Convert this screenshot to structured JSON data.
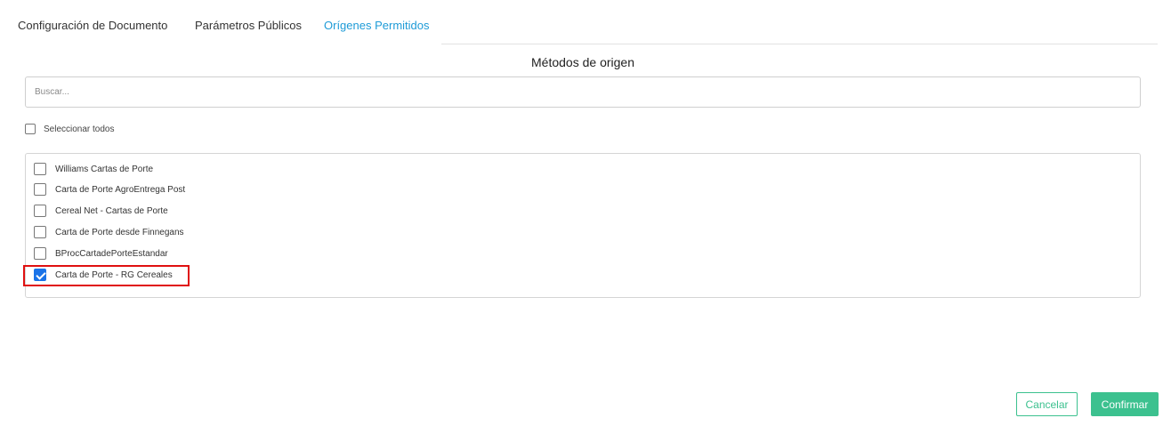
{
  "tabs": [
    {
      "label": "Configuración de Documento",
      "active": false
    },
    {
      "label": "Parámetros Públicos",
      "active": false
    },
    {
      "label": "Orígenes Permitidos",
      "active": true
    }
  ],
  "section": {
    "title": "Métodos de origen"
  },
  "search": {
    "placeholder": "Buscar...",
    "value": ""
  },
  "select_all": {
    "label": "Seleccionar todos",
    "checked": false
  },
  "origins": [
    {
      "label": "Williams Cartas de Porte",
      "checked": false
    },
    {
      "label": "Carta de Porte AgroEntrega Post",
      "checked": false
    },
    {
      "label": "Cereal Net - Cartas de Porte",
      "checked": false
    },
    {
      "label": "Carta de Porte desde Finnegans",
      "checked": false
    },
    {
      "label": "BProcCartadePorteEstandar",
      "checked": false
    },
    {
      "label": "Carta de Porte - RG Cereales",
      "checked": true
    }
  ],
  "footer": {
    "cancel_label": "Cancelar",
    "confirm_label": "Confirmar"
  },
  "colors": {
    "accent": "#1e9bd7",
    "primary_button": "#3cc18f",
    "checkbox_checked": "#1a73e8",
    "highlight": "#e01010"
  }
}
